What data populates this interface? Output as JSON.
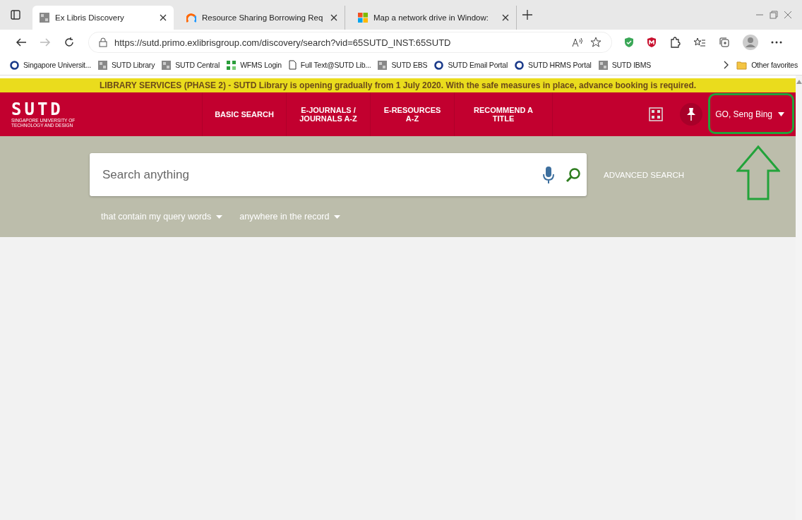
{
  "browser": {
    "tabs": [
      {
        "title": "Ex Libris Discovery",
        "selected": true
      },
      {
        "title": "Resource Sharing Borrowing Req",
        "selected": false
      },
      {
        "title": "Map a network drive in Window:",
        "selected": false
      }
    ],
    "url": "https://sutd.primo.exlibrisgroup.com/discovery/search?vid=65SUTD_INST:65SUTD",
    "bookmarks": [
      {
        "label": "Singapore Universit...",
        "kind": "ring"
      },
      {
        "label": "SUTD Library",
        "kind": "grid"
      },
      {
        "label": "SUTD Central",
        "kind": "grid"
      },
      {
        "label": "WFMS Login",
        "kind": "squares"
      },
      {
        "label": "Full Text@SUTD Lib...",
        "kind": "page"
      },
      {
        "label": "SUTD EBS",
        "kind": "grid"
      },
      {
        "label": "SUTD Email Portal",
        "kind": "ring"
      },
      {
        "label": "SUTD HRMS Portal",
        "kind": "ring"
      },
      {
        "label": "SUTD IBMS",
        "kind": "grid"
      }
    ],
    "other_favorites": "Other favorites"
  },
  "notice": "LIBRARY SERVICES (PHASE 2) - SUTD Library is opening gradually from 1 July 2020. With the safe measures in place, advance booking is required.",
  "logo": {
    "name": "SUTD",
    "tagline": "SINGAPORE UNIVERSITY OF TECHNOLOGY AND DESIGN"
  },
  "nav": [
    {
      "label": "BASIC SEARCH"
    },
    {
      "label": "E-JOURNALS / JOURNALS A-Z"
    },
    {
      "label": "E-RESOURCES A-Z"
    },
    {
      "label": "RECOMMEND A TITLE"
    }
  ],
  "user": "GO, Seng Bing",
  "search": {
    "placeholder": "Search anything",
    "advanced": "ADVANCED SEARCH",
    "filters": [
      "that contain my query words",
      "anywhere in the record"
    ]
  }
}
